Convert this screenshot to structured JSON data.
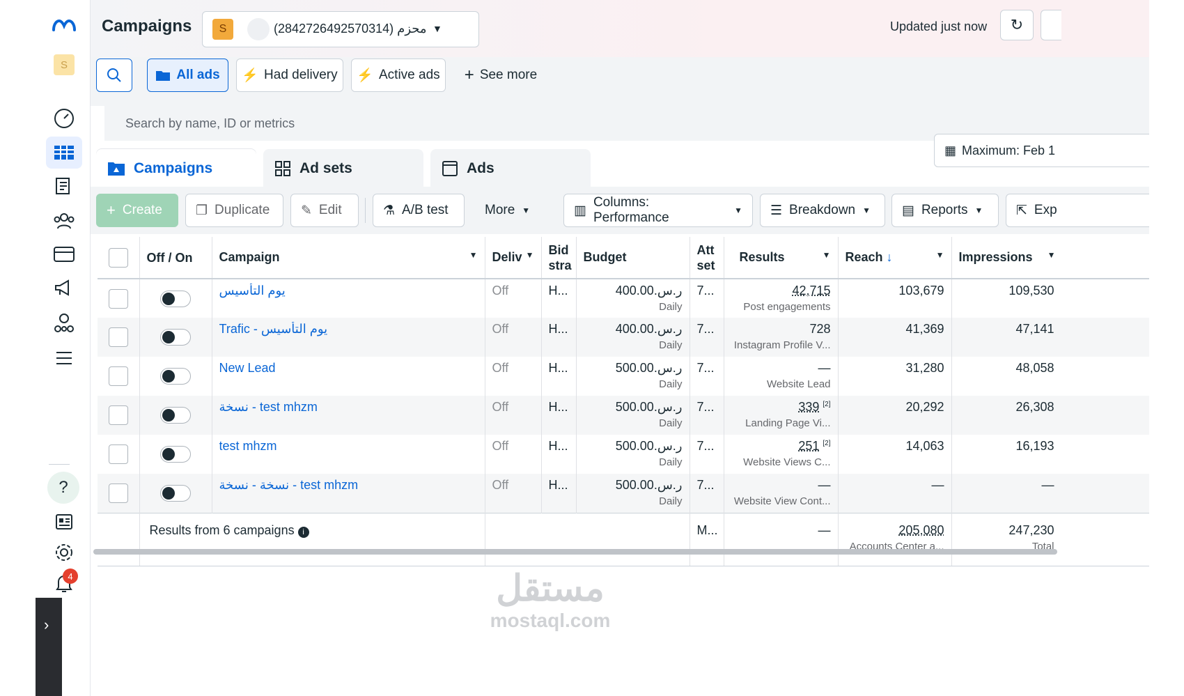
{
  "header": {
    "title": "Campaigns",
    "account_initial": "S",
    "account_name": "(2842726492570314) محزم",
    "updated": "Updated just now"
  },
  "sidebar": {
    "avatar_initial": "S",
    "notification_count": "4"
  },
  "filters": {
    "all_ads": "All ads",
    "had_delivery": "Had delivery",
    "active_ads": "Active ads",
    "see_more": "See more"
  },
  "search": {
    "placeholder": "Search by name, ID or metrics"
  },
  "tabs": {
    "campaigns": "Campaigns",
    "ad_sets": "Ad sets",
    "ads": "Ads"
  },
  "date_range": "Maximum: Feb 1",
  "toolbar": {
    "create": "Create",
    "duplicate": "Duplicate",
    "edit": "Edit",
    "ab_test": "A/B test",
    "more": "More",
    "columns": "Columns: Performance",
    "breakdown": "Breakdown",
    "reports": "Reports",
    "export": "Exp"
  },
  "table": {
    "headers": {
      "off_on": "Off / On",
      "campaign": "Campaign",
      "delivery": "Deliv",
      "bid": "Bid stra",
      "budget": "Budget",
      "attribution": "Att set",
      "results": "Results",
      "reach": "Reach",
      "impressions": "Impressions"
    },
    "rows": [
      {
        "name": "يوم التأسيس",
        "delivery": "Off",
        "bid": "H...",
        "budget": "400.00.ر.س",
        "budget_period": "Daily",
        "attr": "7...",
        "result": "42,715",
        "result_sup": "",
        "result_type": "Post engagements",
        "reach": "103,679",
        "impressions": "109,530"
      },
      {
        "name": "Trafic - يوم التأسيس",
        "delivery": "Off",
        "bid": "H...",
        "budget": "400.00.ر.س",
        "budget_period": "Daily",
        "attr": "7...",
        "result": "728",
        "result_sup": "",
        "result_type": "Instagram Profile V...",
        "reach": "41,369",
        "impressions": "47,141"
      },
      {
        "name": "New Lead",
        "delivery": "Off",
        "bid": "H...",
        "budget": "500.00.ر.س",
        "budget_period": "Daily",
        "attr": "7...",
        "result": "—",
        "result_sup": "",
        "result_type": "Website Lead",
        "reach": "31,280",
        "impressions": "48,058"
      },
      {
        "name": "نسخة - test mhzm",
        "delivery": "Off",
        "bid": "H...",
        "budget": "500.00.ر.س",
        "budget_period": "Daily",
        "attr": "7...",
        "result": "339",
        "result_sup": "[2]",
        "result_type": "Landing Page Vi...",
        "reach": "20,292",
        "impressions": "26,308"
      },
      {
        "name": "test mhzm",
        "delivery": "Off",
        "bid": "H...",
        "budget": "500.00.ر.س",
        "budget_period": "Daily",
        "attr": "7...",
        "result": "251",
        "result_sup": "[2]",
        "result_type": "Website Views C...",
        "reach": "14,063",
        "impressions": "16,193"
      },
      {
        "name": "نسخة - نسخة - test mhzm",
        "delivery": "Off",
        "bid": "H...",
        "budget": "500.00.ر.س",
        "budget_period": "Daily",
        "attr": "7...",
        "result": "—",
        "result_sup": "",
        "result_type": "Website View Cont...",
        "reach": "—",
        "impressions": "—"
      }
    ],
    "summary": {
      "label": "Results from 6 campaigns",
      "attr": "M...",
      "result": "—",
      "reach": "205,080",
      "reach_sub": "Accounts Center a...",
      "impressions": "247,230",
      "impressions_sub": "Total"
    }
  },
  "watermark": {
    "arabic": "مستقل",
    "latin": "mostaql.com"
  }
}
